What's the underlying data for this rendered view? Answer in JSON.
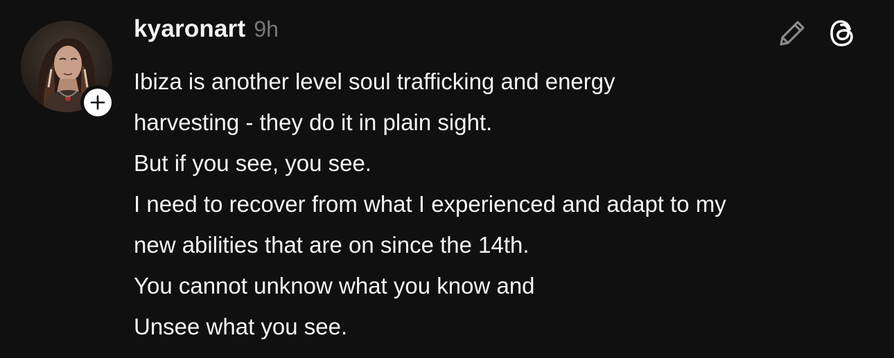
{
  "post": {
    "username": "kyaronart",
    "timestamp": "9h",
    "lines": [
      "Ibiza is another level soul trafficking and energy",
      "harvesting - they do it in plain sight.",
      "But if you see, you see.",
      "I need to recover from what I experienced and adapt to my",
      "new abilities that are on since the 14th.",
      "You cannot unknow what you know and",
      "Unsee what you see."
    ]
  },
  "icons": {
    "follow": "plus-icon",
    "edit": "pencil-icon",
    "app": "threads-logo-icon"
  },
  "colors": {
    "background": "#101010",
    "text": "#f3f5f7",
    "muted": "#777777",
    "icon": "#8a8a8a"
  }
}
